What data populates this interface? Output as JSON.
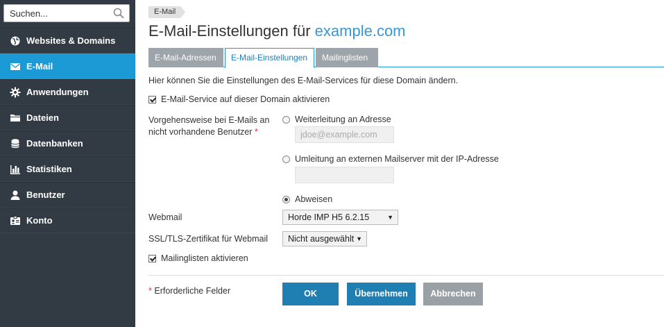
{
  "search": {
    "placeholder": "Suchen..."
  },
  "sidebar": {
    "items": [
      {
        "label": "Websites & Domains",
        "icon": "globe-icon",
        "active": false
      },
      {
        "label": "E-Mail",
        "icon": "envelope-icon",
        "active": true
      },
      {
        "label": "Anwendungen",
        "icon": "gear-icon",
        "active": false
      },
      {
        "label": "Dateien",
        "icon": "folder-icon",
        "active": false
      },
      {
        "label": "Datenbanken",
        "icon": "database-icon",
        "active": false
      },
      {
        "label": "Statistiken",
        "icon": "bar-chart-icon",
        "active": false
      },
      {
        "label": "Benutzer",
        "icon": "user-icon",
        "active": false
      },
      {
        "label": "Konto",
        "icon": "id-card-icon",
        "active": false
      }
    ]
  },
  "breadcrumb": "E-Mail",
  "title": {
    "prefix": "E-Mail-Einstellungen für",
    "domain": "example.com"
  },
  "tabs": [
    {
      "label": "E-Mail-Adressen",
      "active": false
    },
    {
      "label": "E-Mail-Einstellungen",
      "active": true
    },
    {
      "label": "Mailinglisten",
      "active": false
    }
  ],
  "form": {
    "intro": "Hier können Sie die Einstellungen des E-Mail-Services für diese Domain ändern.",
    "mail_service_label": "E-Mail-Service auf dieser Domain aktivieren",
    "mail_service_checked": true,
    "nonexistent_label_line1": "Vorgehensweise bei E-Mails an",
    "nonexistent_label_line2": "nicht vorhandene Benutzer",
    "required_mark": "*",
    "option_forward": "Weiterleitung an Adresse",
    "forward_placeholder": "jdoe@example.com",
    "forward_value": "",
    "option_redirect": "Umleitung an externen Mailserver mit der IP-Adresse",
    "redirect_value": "",
    "option_reject": "Abweisen",
    "selected_option": "reject",
    "webmail_label": "Webmail",
    "webmail_value": "Horde IMP H5 6.2.15",
    "ssl_label": "SSL/TLS-Zertifikat für Webmail",
    "ssl_value": "Nicht ausgewählt",
    "mailing_lists_label": "Mailinglisten aktivieren",
    "mailing_lists_checked": true
  },
  "footer": {
    "required_note": "Erforderliche Felder",
    "ok": "OK",
    "apply": "Übernehmen",
    "cancel": "Abbrechen"
  },
  "colors": {
    "sidebar_bg": "#323b44",
    "active_blue": "#1c9ad6",
    "link_blue": "#3b95d3",
    "primary_button": "#1f7fb2",
    "secondary_button": "#9aa1a6"
  }
}
